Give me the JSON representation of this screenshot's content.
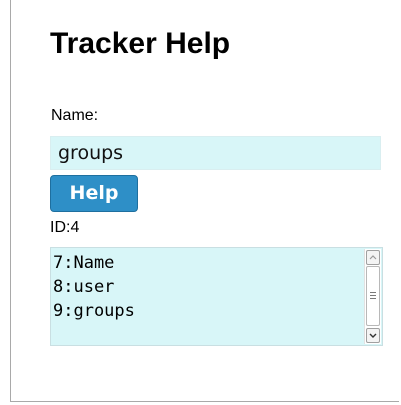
{
  "page": {
    "title": "Tracker Help"
  },
  "form": {
    "name_label": "Name:",
    "name_value": "groups",
    "help_button_label": "Help",
    "id_label": "ID:",
    "id_value": "4"
  },
  "results": {
    "lines": [
      "7:Name",
      "8:user",
      "9:groups"
    ]
  },
  "colors": {
    "input_background": "#d8f6f8",
    "button_background": "#2e8fc7",
    "button_text": "#ffffff"
  },
  "icons": {
    "scroll_up": "chevron-up-icon",
    "scroll_down": "chevron-down-icon",
    "scroll_grip": "grip-lines-icon"
  }
}
